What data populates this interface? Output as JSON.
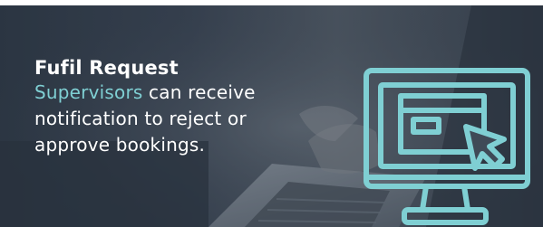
{
  "banner": {
    "title": "Fufil Request",
    "description": {
      "highlight": "Supervisors",
      "line1_rest": " can receive",
      "line2": "notification to reject or",
      "line3": "approve bookings."
    },
    "icon": "computer-monitor-cursor-icon"
  },
  "colors": {
    "accent": "#7fcfd3",
    "text": "#ffffff",
    "background_dark": "#2f3a47"
  }
}
